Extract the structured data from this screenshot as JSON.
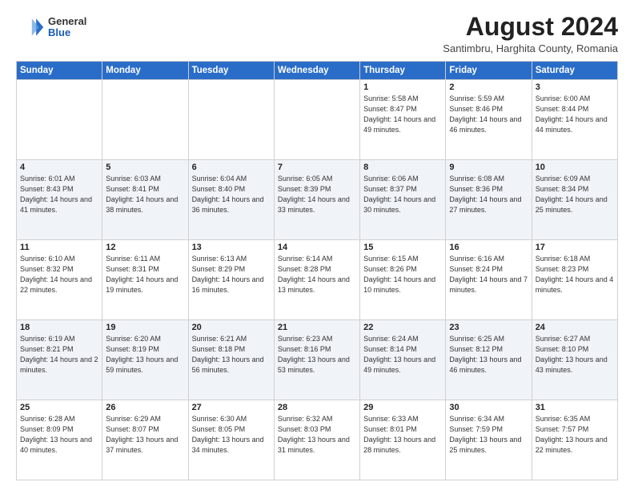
{
  "header": {
    "logo_general": "General",
    "logo_blue": "Blue",
    "month_year": "August 2024",
    "location": "Santimbru, Harghita County, Romania"
  },
  "weekdays": [
    "Sunday",
    "Monday",
    "Tuesday",
    "Wednesday",
    "Thursday",
    "Friday",
    "Saturday"
  ],
  "weeks": [
    [
      {
        "day": "",
        "info": ""
      },
      {
        "day": "",
        "info": ""
      },
      {
        "day": "",
        "info": ""
      },
      {
        "day": "",
        "info": ""
      },
      {
        "day": "1",
        "info": "Sunrise: 5:58 AM\nSunset: 8:47 PM\nDaylight: 14 hours\nand 49 minutes."
      },
      {
        "day": "2",
        "info": "Sunrise: 5:59 AM\nSunset: 8:46 PM\nDaylight: 14 hours\nand 46 minutes."
      },
      {
        "day": "3",
        "info": "Sunrise: 6:00 AM\nSunset: 8:44 PM\nDaylight: 14 hours\nand 44 minutes."
      }
    ],
    [
      {
        "day": "4",
        "info": "Sunrise: 6:01 AM\nSunset: 8:43 PM\nDaylight: 14 hours\nand 41 minutes."
      },
      {
        "day": "5",
        "info": "Sunrise: 6:03 AM\nSunset: 8:41 PM\nDaylight: 14 hours\nand 38 minutes."
      },
      {
        "day": "6",
        "info": "Sunrise: 6:04 AM\nSunset: 8:40 PM\nDaylight: 14 hours\nand 36 minutes."
      },
      {
        "day": "7",
        "info": "Sunrise: 6:05 AM\nSunset: 8:39 PM\nDaylight: 14 hours\nand 33 minutes."
      },
      {
        "day": "8",
        "info": "Sunrise: 6:06 AM\nSunset: 8:37 PM\nDaylight: 14 hours\nand 30 minutes."
      },
      {
        "day": "9",
        "info": "Sunrise: 6:08 AM\nSunset: 8:36 PM\nDaylight: 14 hours\nand 27 minutes."
      },
      {
        "day": "10",
        "info": "Sunrise: 6:09 AM\nSunset: 8:34 PM\nDaylight: 14 hours\nand 25 minutes."
      }
    ],
    [
      {
        "day": "11",
        "info": "Sunrise: 6:10 AM\nSunset: 8:32 PM\nDaylight: 14 hours\nand 22 minutes."
      },
      {
        "day": "12",
        "info": "Sunrise: 6:11 AM\nSunset: 8:31 PM\nDaylight: 14 hours\nand 19 minutes."
      },
      {
        "day": "13",
        "info": "Sunrise: 6:13 AM\nSunset: 8:29 PM\nDaylight: 14 hours\nand 16 minutes."
      },
      {
        "day": "14",
        "info": "Sunrise: 6:14 AM\nSunset: 8:28 PM\nDaylight: 14 hours\nand 13 minutes."
      },
      {
        "day": "15",
        "info": "Sunrise: 6:15 AM\nSunset: 8:26 PM\nDaylight: 14 hours\nand 10 minutes."
      },
      {
        "day": "16",
        "info": "Sunrise: 6:16 AM\nSunset: 8:24 PM\nDaylight: 14 hours\nand 7 minutes."
      },
      {
        "day": "17",
        "info": "Sunrise: 6:18 AM\nSunset: 8:23 PM\nDaylight: 14 hours\nand 4 minutes."
      }
    ],
    [
      {
        "day": "18",
        "info": "Sunrise: 6:19 AM\nSunset: 8:21 PM\nDaylight: 14 hours\nand 2 minutes."
      },
      {
        "day": "19",
        "info": "Sunrise: 6:20 AM\nSunset: 8:19 PM\nDaylight: 13 hours\nand 59 minutes."
      },
      {
        "day": "20",
        "info": "Sunrise: 6:21 AM\nSunset: 8:18 PM\nDaylight: 13 hours\nand 56 minutes."
      },
      {
        "day": "21",
        "info": "Sunrise: 6:23 AM\nSunset: 8:16 PM\nDaylight: 13 hours\nand 53 minutes."
      },
      {
        "day": "22",
        "info": "Sunrise: 6:24 AM\nSunset: 8:14 PM\nDaylight: 13 hours\nand 49 minutes."
      },
      {
        "day": "23",
        "info": "Sunrise: 6:25 AM\nSunset: 8:12 PM\nDaylight: 13 hours\nand 46 minutes."
      },
      {
        "day": "24",
        "info": "Sunrise: 6:27 AM\nSunset: 8:10 PM\nDaylight: 13 hours\nand 43 minutes."
      }
    ],
    [
      {
        "day": "25",
        "info": "Sunrise: 6:28 AM\nSunset: 8:09 PM\nDaylight: 13 hours\nand 40 minutes."
      },
      {
        "day": "26",
        "info": "Sunrise: 6:29 AM\nSunset: 8:07 PM\nDaylight: 13 hours\nand 37 minutes."
      },
      {
        "day": "27",
        "info": "Sunrise: 6:30 AM\nSunset: 8:05 PM\nDaylight: 13 hours\nand 34 minutes."
      },
      {
        "day": "28",
        "info": "Sunrise: 6:32 AM\nSunset: 8:03 PM\nDaylight: 13 hours\nand 31 minutes."
      },
      {
        "day": "29",
        "info": "Sunrise: 6:33 AM\nSunset: 8:01 PM\nDaylight: 13 hours\nand 28 minutes."
      },
      {
        "day": "30",
        "info": "Sunrise: 6:34 AM\nSunset: 7:59 PM\nDaylight: 13 hours\nand 25 minutes."
      },
      {
        "day": "31",
        "info": "Sunrise: 6:35 AM\nSunset: 7:57 PM\nDaylight: 13 hours\nand 22 minutes."
      }
    ]
  ]
}
